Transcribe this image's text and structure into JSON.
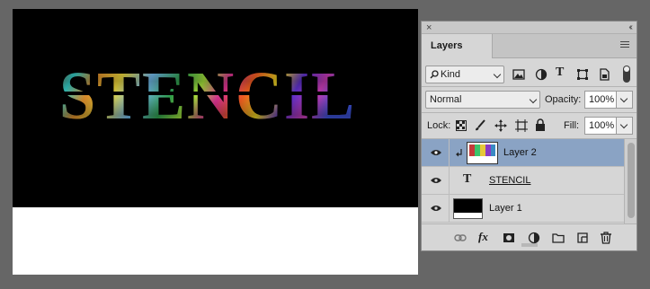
{
  "canvas": {
    "artwork_text": "STENCIL",
    "background_top": "#000000",
    "background_bottom": "#ffffff"
  },
  "panel": {
    "close_glyph": "×",
    "collapse_glyph": "‹‹",
    "tab_label": "Layers",
    "menu_icon": "panel-menu-icon",
    "filter": {
      "kind_value": "Kind",
      "kind_icon": "search-icon",
      "icons": [
        "pixel-filter-icon",
        "adjustment-filter-icon",
        "type-filter-icon",
        "shape-filter-icon",
        "smart-object-filter-icon"
      ],
      "type_glyph": "T"
    },
    "blend": {
      "mode_value": "Normal",
      "opacity_label": "Opacity:",
      "opacity_value": "100%"
    },
    "lock": {
      "label": "Lock:",
      "icons": [
        "lock-transparent-icon",
        "lock-image-icon",
        "lock-position-icon",
        "lock-artboard-icon",
        "lock-all-icon"
      ],
      "fill_label": "Fill:",
      "fill_value": "100%"
    },
    "layers": [
      {
        "name": "Layer 2",
        "selected": true,
        "clipped": true,
        "kind": "raster"
      },
      {
        "name": "STENCIL",
        "selected": false,
        "clipped": false,
        "kind": "type",
        "type_glyph": "T"
      },
      {
        "name": "Layer 1",
        "selected": false,
        "clipped": false,
        "kind": "raster"
      }
    ],
    "bottom_icons": [
      "link-layers-icon",
      "fx-icon",
      "add-mask-icon",
      "new-adjustment-icon",
      "new-group-icon",
      "new-layer-icon",
      "delete-layer-icon"
    ],
    "fx_label": "fx"
  },
  "colors": {
    "app_bg": "#666666",
    "panel_bg": "#d6d6d6",
    "selected_row": "#8aa3c4"
  }
}
